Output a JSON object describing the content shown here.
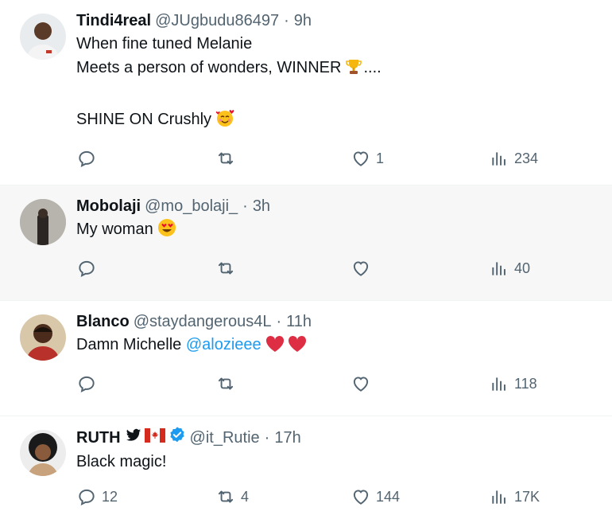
{
  "tweets": [
    {
      "name": "Tindi4real",
      "handle": "@JUgbudu86497",
      "time": "9h",
      "lines": [
        "When fine tuned Melanie",
        "Meets a person of wonders, WINNER",
        "",
        "SHINE ON Crushly"
      ],
      "line2_suffix": "....",
      "replies": "",
      "retweets": "",
      "likes": "1",
      "views": "234"
    },
    {
      "name": "Mobolaji",
      "handle": "@mo_bolaji_",
      "time": "3h",
      "lines": [
        "My woman"
      ],
      "replies": "",
      "retweets": "",
      "likes": "",
      "views": "40"
    },
    {
      "name": "Blanco",
      "handle": "@staydangerous4L",
      "time": "11h",
      "text_prefix": "Damn Michelle",
      "mention": "@alozieee",
      "replies": "",
      "retweets": "",
      "likes": "",
      "views": "118"
    },
    {
      "name": "RUTH",
      "handle": "@it_Rutie",
      "time": "17h",
      "lines": [
        "Black magic!"
      ],
      "replies": "12",
      "retweets": "4",
      "likes": "144",
      "views": "17K"
    }
  ],
  "separator": "·",
  "colors": {
    "text": "#0f1419",
    "secondary": "#536471",
    "link": "#1d9bf0",
    "verified": "#1d9bf0",
    "hover_bg": "#f7f7f7"
  },
  "icons": [
    "reply-icon",
    "retweet-icon",
    "like-icon",
    "views-icon",
    "verified-icon",
    "trophy-emoji",
    "smiling-hearts-emoji",
    "heart-eyes-emoji",
    "red-heart-emoji",
    "bird-icon",
    "canada-flag-icon"
  ]
}
